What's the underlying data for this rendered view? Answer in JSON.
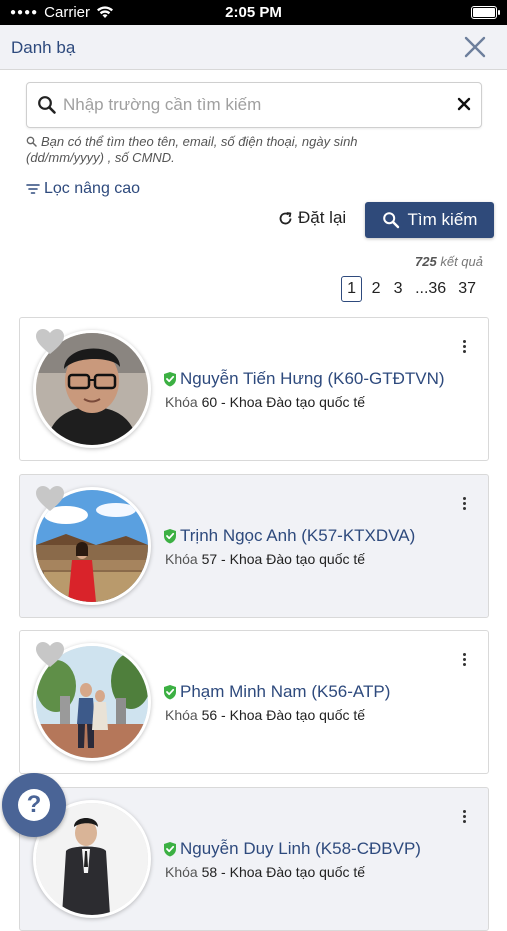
{
  "status_bar": {
    "carrier": "Carrier",
    "time": "2:05 PM"
  },
  "nav": {
    "title": "Danh bạ"
  },
  "search": {
    "placeholder": "Nhập trường cần tìm kiếm",
    "value": ""
  },
  "hint": "Bạn có thể tìm theo tên, email, số điện thoại, ngày sinh (dd/mm/yyyy) , số CMND.",
  "advanced_filter_label": "Lọc nâng cao",
  "reset_label": "Đặt lại",
  "search_button_label": "Tìm kiếm",
  "result_count": {
    "number": "725",
    "label": "kết quả"
  },
  "pagination": {
    "pages": [
      "1",
      "2",
      "3",
      "...36",
      "37"
    ],
    "active": "1"
  },
  "contacts": [
    {
      "name": "Nguyễn Tiến Hưng (K60-GTĐTVN)",
      "khoa_label": "Khóa",
      "khoa": "60",
      "faculty": "Khoa Đào tạo quốc tế"
    },
    {
      "name": "Trịnh Ngọc Anh (K57-KTXDVA)",
      "khoa_label": "Khóa",
      "khoa": "57",
      "faculty": "Khoa Đào tạo quốc tế"
    },
    {
      "name": "Phạm Minh Nam (K56-ATP)",
      "khoa_label": "Khóa",
      "khoa": "56",
      "faculty": "Khoa Đào tạo quốc tế"
    },
    {
      "name": "Nguyễn Duy Linh (K58-CĐBVP)",
      "khoa_label": "Khóa",
      "khoa": "58",
      "faculty": "Khoa Đào tạo quốc tế"
    }
  ],
  "help_button": "?",
  "colors": {
    "primary": "#2f4a7a",
    "link": "#2e4a7d",
    "verified": "#3cb043",
    "card_alt": "#f1f2f6"
  }
}
